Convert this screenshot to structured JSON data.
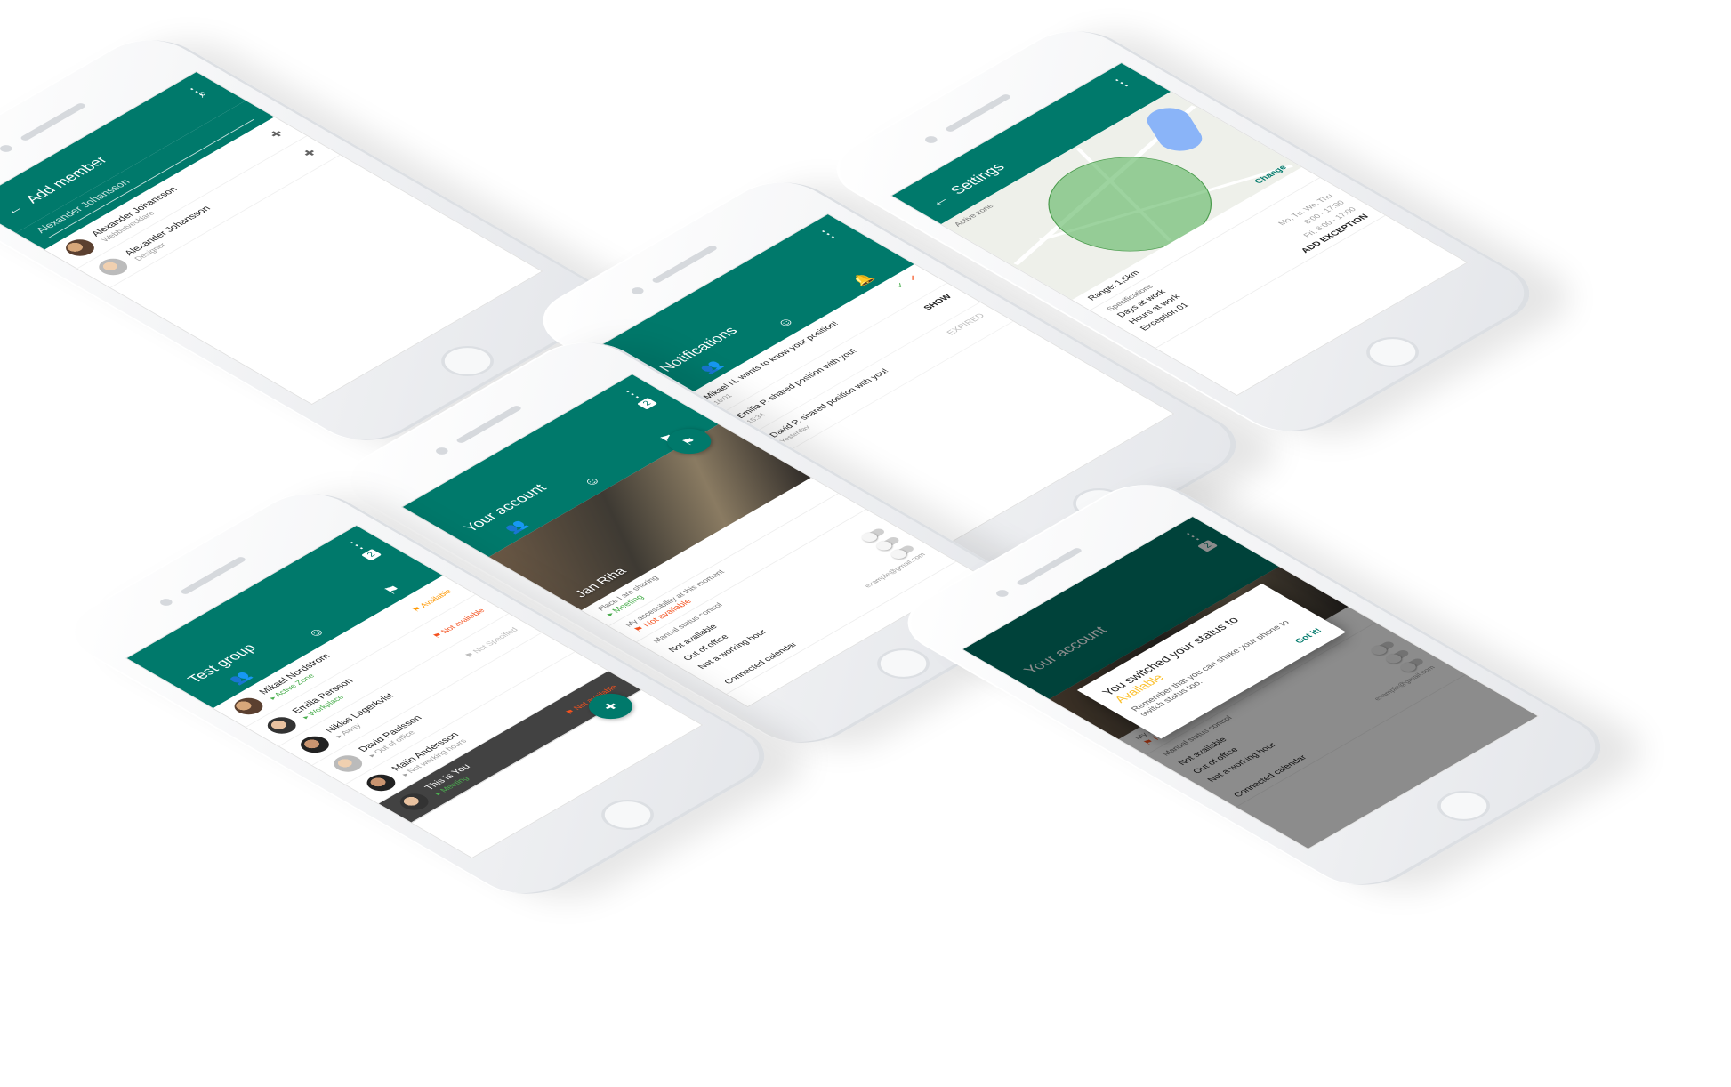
{
  "colors": {
    "primary": "#00796b",
    "accent_green": "#4caf50",
    "accent_orange": "#ff9800",
    "accent_red": "#f4511e",
    "accent_yellow": "#fbc02d"
  },
  "add_member": {
    "title": "Add member",
    "search_value": "Alexander Johansson",
    "results": [
      {
        "name": "Alexander Johansson",
        "role": "Webbutvecklare"
      },
      {
        "name": "Alexander Johansson",
        "role": "Designer"
      }
    ]
  },
  "notifications": {
    "title": "Notifications",
    "items": [
      {
        "text": "Mikael N. wants to know your position!",
        "time": "16:01",
        "action": "SHOW"
      },
      {
        "text": "Emilia P. shared position with you!",
        "time": "15:34",
        "action": ""
      },
      {
        "text": "David P. shared position with you!",
        "time": "Yesterday",
        "action": "EXPIRED"
      }
    ]
  },
  "settings": {
    "title": "Settings",
    "active_zone_label": "Active zone",
    "change_label": "Change",
    "range_label": "Range: 1,5km",
    "specifications_label": "Specifications",
    "days_at_work": "Days at work",
    "days_value": "Mo, Tu, We, Thu",
    "hours_at_work": "Hours at work",
    "hours_value": "8:00 - 17:00",
    "exception": "Exception 01",
    "exception_value": "Fri, 8:00 - 17:00",
    "add_exception": "ADD EXCEPTION"
  },
  "your_account": {
    "title": "Your account",
    "badge": "2",
    "profile_name": "Jan Riha",
    "place_label": "Place I am sharing",
    "place_value": "Meeting",
    "accessibility_label": "My accessibility at this moment",
    "accessibility_value": "Not available",
    "manual_label": "Manual status control",
    "manual_items": [
      "Not available",
      "Out of office",
      "Not a working hour"
    ],
    "email": "example@gmail.com",
    "connected_calendar": "Connected calendar"
  },
  "test_group": {
    "title": "Test group",
    "badge": "2",
    "members": [
      {
        "name": "Mikael Nordstrom",
        "place": "Active Zone",
        "status": "Available"
      },
      {
        "name": "Emilia Persson",
        "place": "Workplace",
        "status": "Not available"
      },
      {
        "name": "Niklas Lagerkvist",
        "place": "Away",
        "status": "Not Specified"
      },
      {
        "name": "David Paulsson",
        "place": "Out of office",
        "status": ""
      },
      {
        "name": "Malin Andersson",
        "place": "Not working hours",
        "status": ""
      }
    ],
    "you": {
      "name": "This is You",
      "place": "Meeting",
      "status": "Not available"
    }
  },
  "status_dialog": {
    "title_prefix": "You switched your status to ",
    "title_accent": "Available",
    "body": "Remember that you can shake your phone to switch status too.",
    "button": "Got it!",
    "bg_title": "Your account",
    "bg_badge": "2",
    "accessibility_label": "My accessibility at this moment",
    "accessibility_value": "Not available",
    "manual_label": "Manual status control",
    "manual_items": [
      "Not available",
      "Out of office",
      "Not a working hour"
    ],
    "email": "example@gmail.com",
    "connected_calendar": "Connected calendar"
  }
}
